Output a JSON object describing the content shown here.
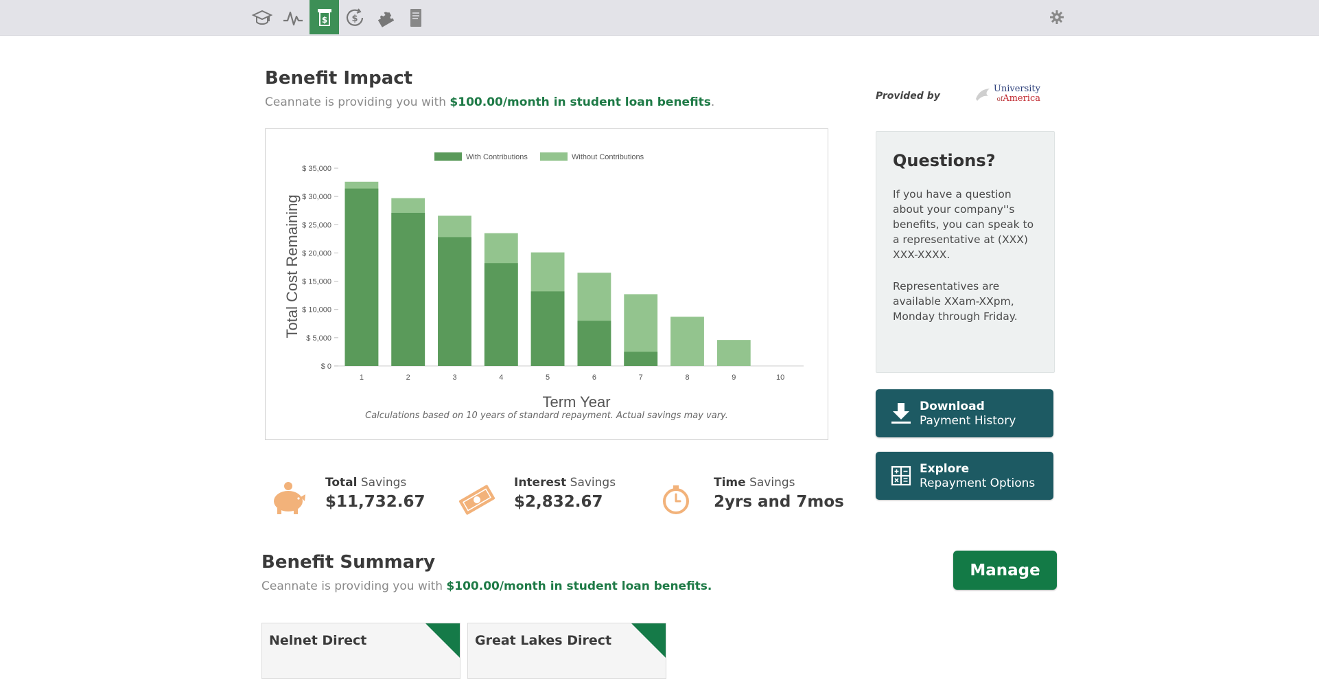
{
  "nav": {
    "items": [
      {
        "name": "education-icon",
        "active": false
      },
      {
        "name": "activity-icon",
        "active": false
      },
      {
        "name": "benefits-icon",
        "active": true
      },
      {
        "name": "refinance-icon",
        "active": false
      },
      {
        "name": "puzzle-icon",
        "active": false
      },
      {
        "name": "document-icon",
        "active": false
      }
    ],
    "settings_icon": "gear-icon"
  },
  "impact": {
    "title": "Benefit Impact",
    "subtitle_prefix": "Ceannate is providing you with ",
    "subtitle_highlight": "$100.00/month in student loan benefits",
    "subtitle_suffix": "."
  },
  "chart_data": {
    "type": "bar",
    "stacked": true,
    "categories": [
      "1",
      "2",
      "3",
      "4",
      "5",
      "6",
      "7",
      "8",
      "9",
      "10"
    ],
    "series": [
      {
        "name": "With Contributions",
        "color": "#5a9a5a",
        "values": [
          31400,
          27100,
          22800,
          18200,
          13200,
          8000,
          2500,
          0,
          0,
          0
        ]
      },
      {
        "name": "Without Contributions",
        "color": "#93c48e",
        "values": [
          32600,
          29700,
          26600,
          23500,
          20100,
          16500,
          12700,
          8700,
          4600,
          0
        ]
      }
    ],
    "xlabel": "Term Year",
    "ylabel": "Total Cost Remaining",
    "ylim": [
      0,
      35000
    ],
    "yticks": [
      "$ 0",
      "$ 5,000",
      "$ 10,000",
      "$ 15,000",
      "$ 20,000",
      "$ 25,000",
      "$ 30,000",
      "$ 35,000"
    ],
    "legend_position": "top",
    "note": "Calculations based on 10 years of standard repayment. Actual savings may vary."
  },
  "stats": [
    {
      "bold": "Total",
      "rest": " Savings",
      "value": "$11,732.67",
      "icon": "piggy-bank-icon"
    },
    {
      "bold": "Interest",
      "rest": " Savings",
      "value": "$2,832.67",
      "icon": "money-bill-icon"
    },
    {
      "bold": "Time",
      "rest": " Savings",
      "value": "2yrs and 7mos",
      "icon": "stopwatch-icon"
    }
  ],
  "sidebar": {
    "provided_by": "Provided by",
    "logo_line1": "University",
    "logo_of": "of",
    "logo_line2": "America",
    "questions_title": "Questions?",
    "questions_p1": "If you have a question about your company''s benefits, you can speak to a representative at (XXX) XXX-XXXX.",
    "questions_p2": "Representatives are available XXam-XXpm, Monday through Friday.",
    "download_line1": "Download",
    "download_line2": "Payment History",
    "explore_line1": "Explore",
    "explore_line2": "Repayment Options"
  },
  "summary": {
    "title": "Benefit Summary",
    "subtitle_prefix": "Ceannate is providing you with ",
    "subtitle_highlight": "$100.00/month in student loan benefits.",
    "manage_label": "Manage",
    "cards": [
      "Nelnet Direct",
      "Great Lakes Direct"
    ]
  }
}
